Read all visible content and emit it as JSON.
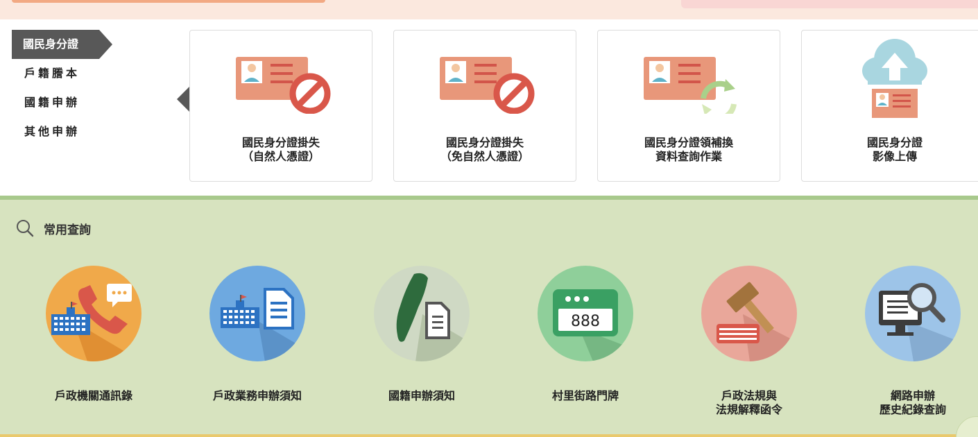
{
  "side_nav": {
    "items": [
      {
        "label": "國民身分證",
        "active": true
      },
      {
        "label": "戶籍謄本",
        "active": false
      },
      {
        "label": "國籍申辦",
        "active": false
      },
      {
        "label": "其他申辦",
        "active": false
      }
    ]
  },
  "cards": [
    {
      "line1": "國民身分證掛失",
      "line2": "（自然人憑證）",
      "icon": "id-card-prohibited-icon"
    },
    {
      "line1": "國民身分證掛失",
      "line2": "（免自然人憑證）",
      "icon": "id-card-prohibited-icon"
    },
    {
      "line1": "國民身分證領補換",
      "line2": "資料查詢作業",
      "icon": "id-card-renew-icon"
    },
    {
      "line1": "國民身分證",
      "line2": "影像上傳",
      "icon": "cloud-upload-icon"
    }
  ],
  "quick_section": {
    "title": "常用查詢",
    "items": [
      {
        "line1": "戶政機關通訊錄",
        "line2": "",
        "icon": "office-phone-icon"
      },
      {
        "line1": "戶政業務申辦須知",
        "line2": "",
        "icon": "office-document-icon"
      },
      {
        "line1": "國籍申辦須知",
        "line2": "",
        "icon": "taiwan-document-icon"
      },
      {
        "line1": "村里街路門牌",
        "line2": "",
        "icon": "door-plate-icon"
      },
      {
        "line1": "戶政法規與",
        "line2": "法規解釋函令",
        "icon": "gavel-law-icon"
      },
      {
        "line1": "網路申辦",
        "line2": "歷史紀錄查詢",
        "icon": "computer-search-icon"
      }
    ]
  },
  "door_plate_number": "888",
  "colors": {
    "nav_active": "#585858",
    "band": "#d7e3bf",
    "band_line": "#a8c98c",
    "card_orange": "#e8977a",
    "prohibit_red": "#d9574a"
  }
}
